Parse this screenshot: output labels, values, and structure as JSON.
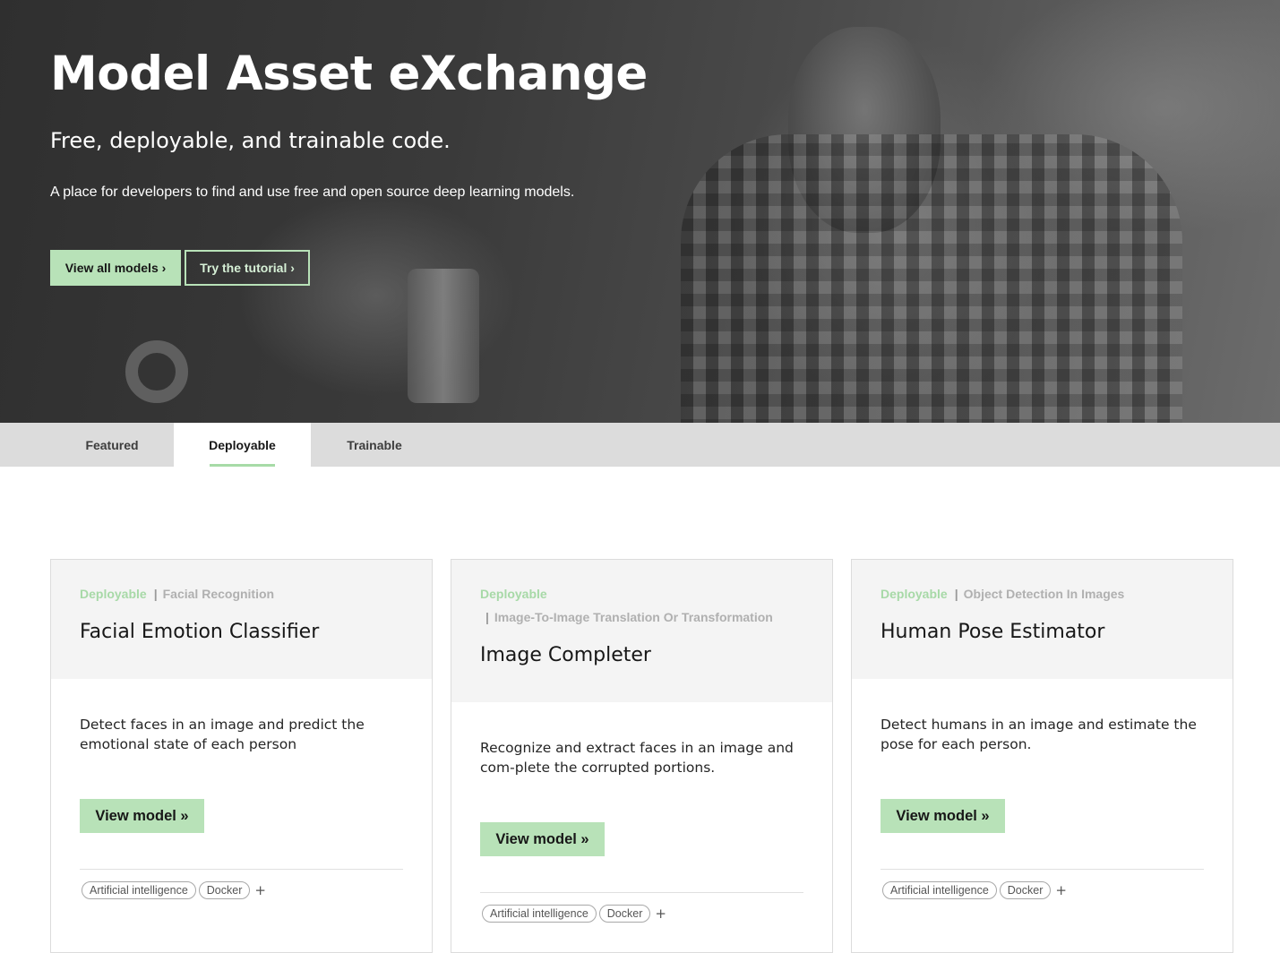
{
  "hero": {
    "title": "Model Asset eXchange",
    "subtitle": "Free, deployable, and trainable code.",
    "description": "A place for developers to find and use free and open source deep learning models.",
    "primary_button": "View all models ›",
    "secondary_button": "Try the tutorial ›"
  },
  "tabs": [
    {
      "label": "Featured",
      "active": false
    },
    {
      "label": "Deployable",
      "active": true
    },
    {
      "label": "Trainable",
      "active": false
    }
  ],
  "cards": [
    {
      "type_label": "Deployable",
      "category": "Facial Recognition",
      "title": "Facial Emotion Classifier",
      "description": "Detect faces in an image and predict the emotional state of each person",
      "button": "View model »",
      "chips": [
        "Artificial intelligence",
        "Docker"
      ],
      "more": "+"
    },
    {
      "type_label": "Deployable",
      "category": "Image-To-Image Translation Or Transformation",
      "title": "Image Completer",
      "description": "Recognize and extract faces in an image and com-plete the corrupted portions.",
      "button": "View model »",
      "chips": [
        "Artificial intelligence",
        "Docker"
      ],
      "more": "+"
    },
    {
      "type_label": "Deployable",
      "category": "Object Detection In Images",
      "title": "Human Pose Estimator",
      "description": "Detect humans in an image and estimate the pose for each person.",
      "button": "View model »",
      "chips": [
        "Artificial intelligence",
        "Docker"
      ],
      "more": "+"
    }
  ],
  "colors": {
    "accent_green": "#b8e2b8",
    "tag_green": "#a7d9a7",
    "tab_bar": "#dcdcdc",
    "card_header": "#f4f4f4"
  }
}
